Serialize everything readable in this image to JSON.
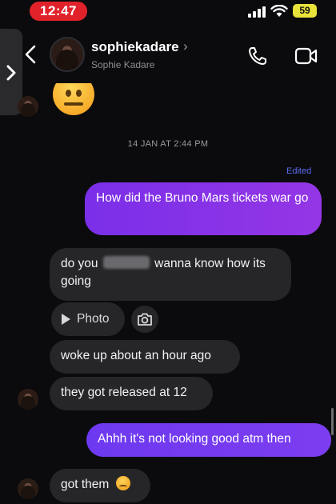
{
  "status_bar": {
    "time": "12:47",
    "battery": "59",
    "colors": {
      "time_pill": "#e2222b",
      "battery": "#e8e23a"
    }
  },
  "header": {
    "username": "sophiekadare",
    "chevron": "›",
    "display_name": "Sophie Kadare",
    "icons": [
      "back-icon",
      "phone-icon",
      "video-icon"
    ]
  },
  "chat": {
    "timestamp": "14 JAN AT 2:44 PM",
    "edited_label": "Edited",
    "messages": [
      {
        "dir": "in",
        "kind": "emoji",
        "emoji": "neutral-face"
      },
      {
        "dir": "out",
        "text": "How did the Bruno Mars tickets war go"
      },
      {
        "dir": "in",
        "text_before": "do you",
        "text_after": "wanna know how its going",
        "redacted": true
      },
      {
        "dir": "in",
        "kind": "photo",
        "label": "Photo"
      },
      {
        "dir": "in",
        "text": "woke up about an hour ago"
      },
      {
        "dir": "in",
        "text": "they got released at 12"
      },
      {
        "dir": "out",
        "text": "Ahhh it's not looking good atm then"
      },
      {
        "dir": "in",
        "text": "got them",
        "emoji": "relieved-face"
      }
    ],
    "colors": {
      "outgoing": "#8a33e8",
      "incoming": "#262629",
      "edited": "#5b6cf2"
    }
  }
}
